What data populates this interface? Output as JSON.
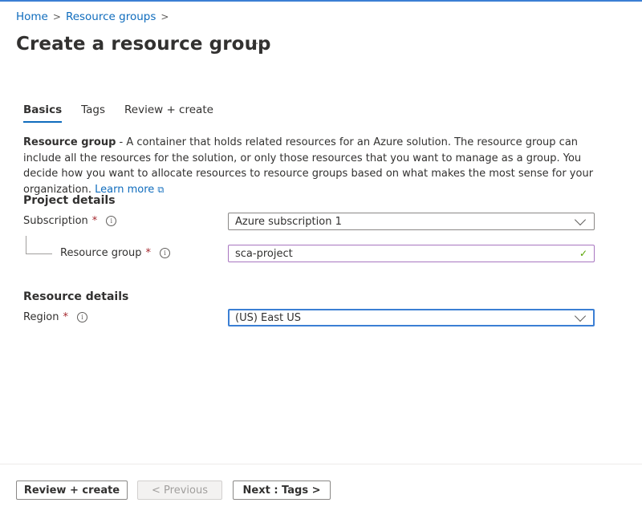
{
  "breadcrumb": {
    "items": [
      "Home",
      "Resource groups"
    ],
    "separator": ">"
  },
  "page": {
    "title": "Create a resource group",
    "more_label": "···"
  },
  "tabs": [
    {
      "label": "Basics",
      "active": true
    },
    {
      "label": "Tags",
      "active": false
    },
    {
      "label": "Review + create",
      "active": false
    }
  ],
  "description": {
    "bold": "Resource group",
    "text": " - A container that holds related resources for an Azure solution. The resource group can include all the resources for the solution, or only those resources that you want to manage as a group. You decide how you want to allocate resources to resource groups based on what makes the most sense for your organization. ",
    "link": "Learn more",
    "link_icon": "external-link-icon"
  },
  "project_details": {
    "heading": "Project details",
    "subscription": {
      "label": "Subscription",
      "required": "*",
      "value": "Azure subscription 1"
    },
    "resource_group": {
      "label": "Resource group",
      "required": "*",
      "value": "sca-project",
      "valid_icon": "✓"
    }
  },
  "resource_details": {
    "heading": "Resource details",
    "region": {
      "label": "Region",
      "required": "*",
      "value": "(US) East US"
    }
  },
  "info_glyph": "i",
  "footer": {
    "review_create": "Review + create",
    "previous": "< Previous",
    "next": "Next : Tags >"
  },
  "colors": {
    "accent": "#0f6cbd",
    "required": "#a4262c",
    "valid": "#57a300"
  }
}
